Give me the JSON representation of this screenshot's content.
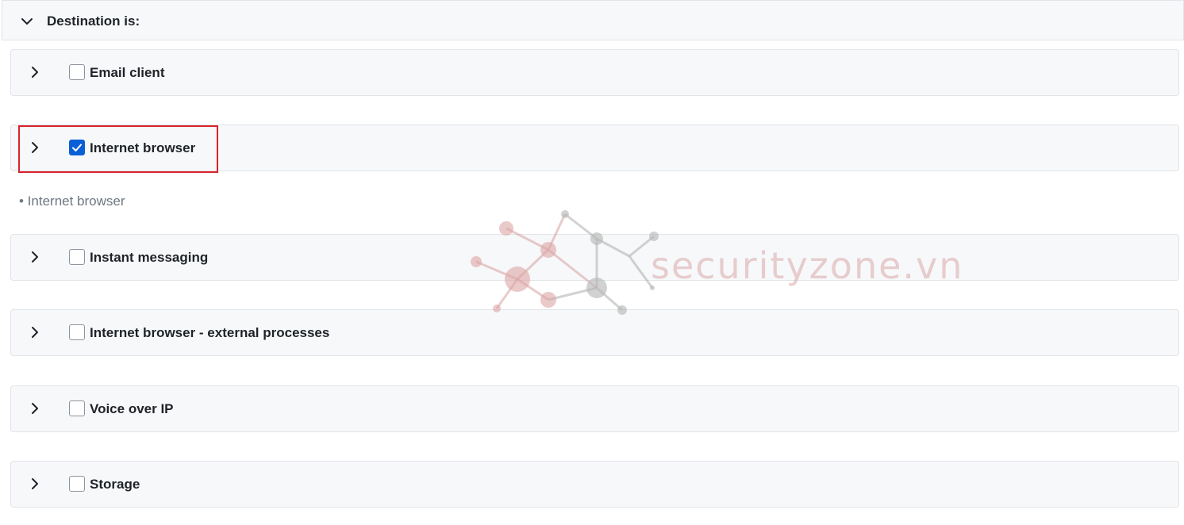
{
  "section": {
    "title": "Destination is:",
    "expand_icon": "chevron-down-icon"
  },
  "rows": [
    {
      "label": "Email client",
      "checked": false
    },
    {
      "label": "Internet browser",
      "checked": true
    },
    {
      "label": "Instant messaging",
      "checked": false
    },
    {
      "label": "Internet browser - external processes",
      "checked": false
    },
    {
      "label": "Voice over IP",
      "checked": false
    },
    {
      "label": "Storage",
      "checked": false
    }
  ],
  "selected_summary": "• Internet browser",
  "watermark": {
    "text": "securityzone.vn"
  },
  "colors": {
    "accent": "#0a5fd6",
    "highlight": "#d9232d",
    "row_bg": "#f7f8fa"
  }
}
